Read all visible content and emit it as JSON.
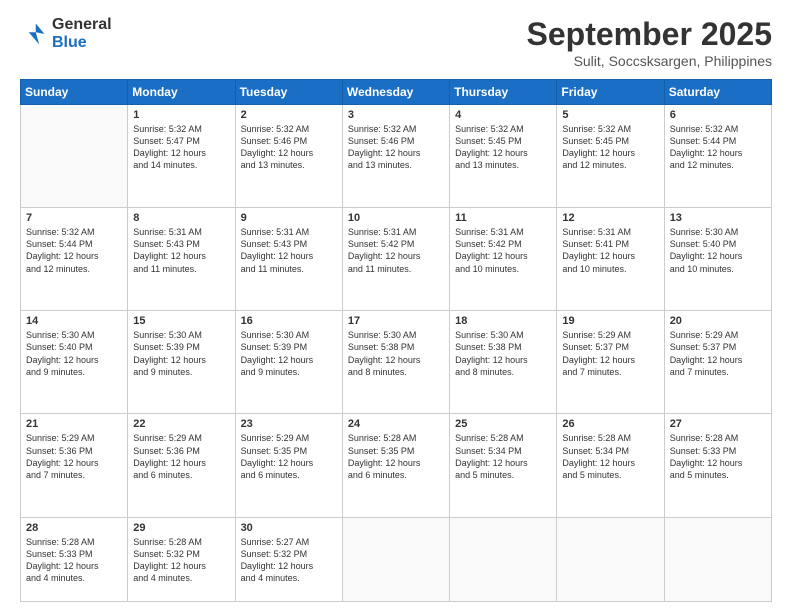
{
  "header": {
    "logo_line1": "General",
    "logo_line2": "Blue",
    "month": "September 2025",
    "location": "Sulit, Soccsksargen, Philippines"
  },
  "weekdays": [
    "Sunday",
    "Monday",
    "Tuesday",
    "Wednesday",
    "Thursday",
    "Friday",
    "Saturday"
  ],
  "weeks": [
    [
      {
        "day": "",
        "info": ""
      },
      {
        "day": "1",
        "info": "Sunrise: 5:32 AM\nSunset: 5:47 PM\nDaylight: 12 hours\nand 14 minutes."
      },
      {
        "day": "2",
        "info": "Sunrise: 5:32 AM\nSunset: 5:46 PM\nDaylight: 12 hours\nand 13 minutes."
      },
      {
        "day": "3",
        "info": "Sunrise: 5:32 AM\nSunset: 5:46 PM\nDaylight: 12 hours\nand 13 minutes."
      },
      {
        "day": "4",
        "info": "Sunrise: 5:32 AM\nSunset: 5:45 PM\nDaylight: 12 hours\nand 13 minutes."
      },
      {
        "day": "5",
        "info": "Sunrise: 5:32 AM\nSunset: 5:45 PM\nDaylight: 12 hours\nand 12 minutes."
      },
      {
        "day": "6",
        "info": "Sunrise: 5:32 AM\nSunset: 5:44 PM\nDaylight: 12 hours\nand 12 minutes."
      }
    ],
    [
      {
        "day": "7",
        "info": "Sunrise: 5:32 AM\nSunset: 5:44 PM\nDaylight: 12 hours\nand 12 minutes."
      },
      {
        "day": "8",
        "info": "Sunrise: 5:31 AM\nSunset: 5:43 PM\nDaylight: 12 hours\nand 11 minutes."
      },
      {
        "day": "9",
        "info": "Sunrise: 5:31 AM\nSunset: 5:43 PM\nDaylight: 12 hours\nand 11 minutes."
      },
      {
        "day": "10",
        "info": "Sunrise: 5:31 AM\nSunset: 5:42 PM\nDaylight: 12 hours\nand 11 minutes."
      },
      {
        "day": "11",
        "info": "Sunrise: 5:31 AM\nSunset: 5:42 PM\nDaylight: 12 hours\nand 10 minutes."
      },
      {
        "day": "12",
        "info": "Sunrise: 5:31 AM\nSunset: 5:41 PM\nDaylight: 12 hours\nand 10 minutes."
      },
      {
        "day": "13",
        "info": "Sunrise: 5:30 AM\nSunset: 5:40 PM\nDaylight: 12 hours\nand 10 minutes."
      }
    ],
    [
      {
        "day": "14",
        "info": "Sunrise: 5:30 AM\nSunset: 5:40 PM\nDaylight: 12 hours\nand 9 minutes."
      },
      {
        "day": "15",
        "info": "Sunrise: 5:30 AM\nSunset: 5:39 PM\nDaylight: 12 hours\nand 9 minutes."
      },
      {
        "day": "16",
        "info": "Sunrise: 5:30 AM\nSunset: 5:39 PM\nDaylight: 12 hours\nand 9 minutes."
      },
      {
        "day": "17",
        "info": "Sunrise: 5:30 AM\nSunset: 5:38 PM\nDaylight: 12 hours\nand 8 minutes."
      },
      {
        "day": "18",
        "info": "Sunrise: 5:30 AM\nSunset: 5:38 PM\nDaylight: 12 hours\nand 8 minutes."
      },
      {
        "day": "19",
        "info": "Sunrise: 5:29 AM\nSunset: 5:37 PM\nDaylight: 12 hours\nand 7 minutes."
      },
      {
        "day": "20",
        "info": "Sunrise: 5:29 AM\nSunset: 5:37 PM\nDaylight: 12 hours\nand 7 minutes."
      }
    ],
    [
      {
        "day": "21",
        "info": "Sunrise: 5:29 AM\nSunset: 5:36 PM\nDaylight: 12 hours\nand 7 minutes."
      },
      {
        "day": "22",
        "info": "Sunrise: 5:29 AM\nSunset: 5:36 PM\nDaylight: 12 hours\nand 6 minutes."
      },
      {
        "day": "23",
        "info": "Sunrise: 5:29 AM\nSunset: 5:35 PM\nDaylight: 12 hours\nand 6 minutes."
      },
      {
        "day": "24",
        "info": "Sunrise: 5:28 AM\nSunset: 5:35 PM\nDaylight: 12 hours\nand 6 minutes."
      },
      {
        "day": "25",
        "info": "Sunrise: 5:28 AM\nSunset: 5:34 PM\nDaylight: 12 hours\nand 5 minutes."
      },
      {
        "day": "26",
        "info": "Sunrise: 5:28 AM\nSunset: 5:34 PM\nDaylight: 12 hours\nand 5 minutes."
      },
      {
        "day": "27",
        "info": "Sunrise: 5:28 AM\nSunset: 5:33 PM\nDaylight: 12 hours\nand 5 minutes."
      }
    ],
    [
      {
        "day": "28",
        "info": "Sunrise: 5:28 AM\nSunset: 5:33 PM\nDaylight: 12 hours\nand 4 minutes."
      },
      {
        "day": "29",
        "info": "Sunrise: 5:28 AM\nSunset: 5:32 PM\nDaylight: 12 hours\nand 4 minutes."
      },
      {
        "day": "30",
        "info": "Sunrise: 5:27 AM\nSunset: 5:32 PM\nDaylight: 12 hours\nand 4 minutes."
      },
      {
        "day": "",
        "info": ""
      },
      {
        "day": "",
        "info": ""
      },
      {
        "day": "",
        "info": ""
      },
      {
        "day": "",
        "info": ""
      }
    ]
  ]
}
